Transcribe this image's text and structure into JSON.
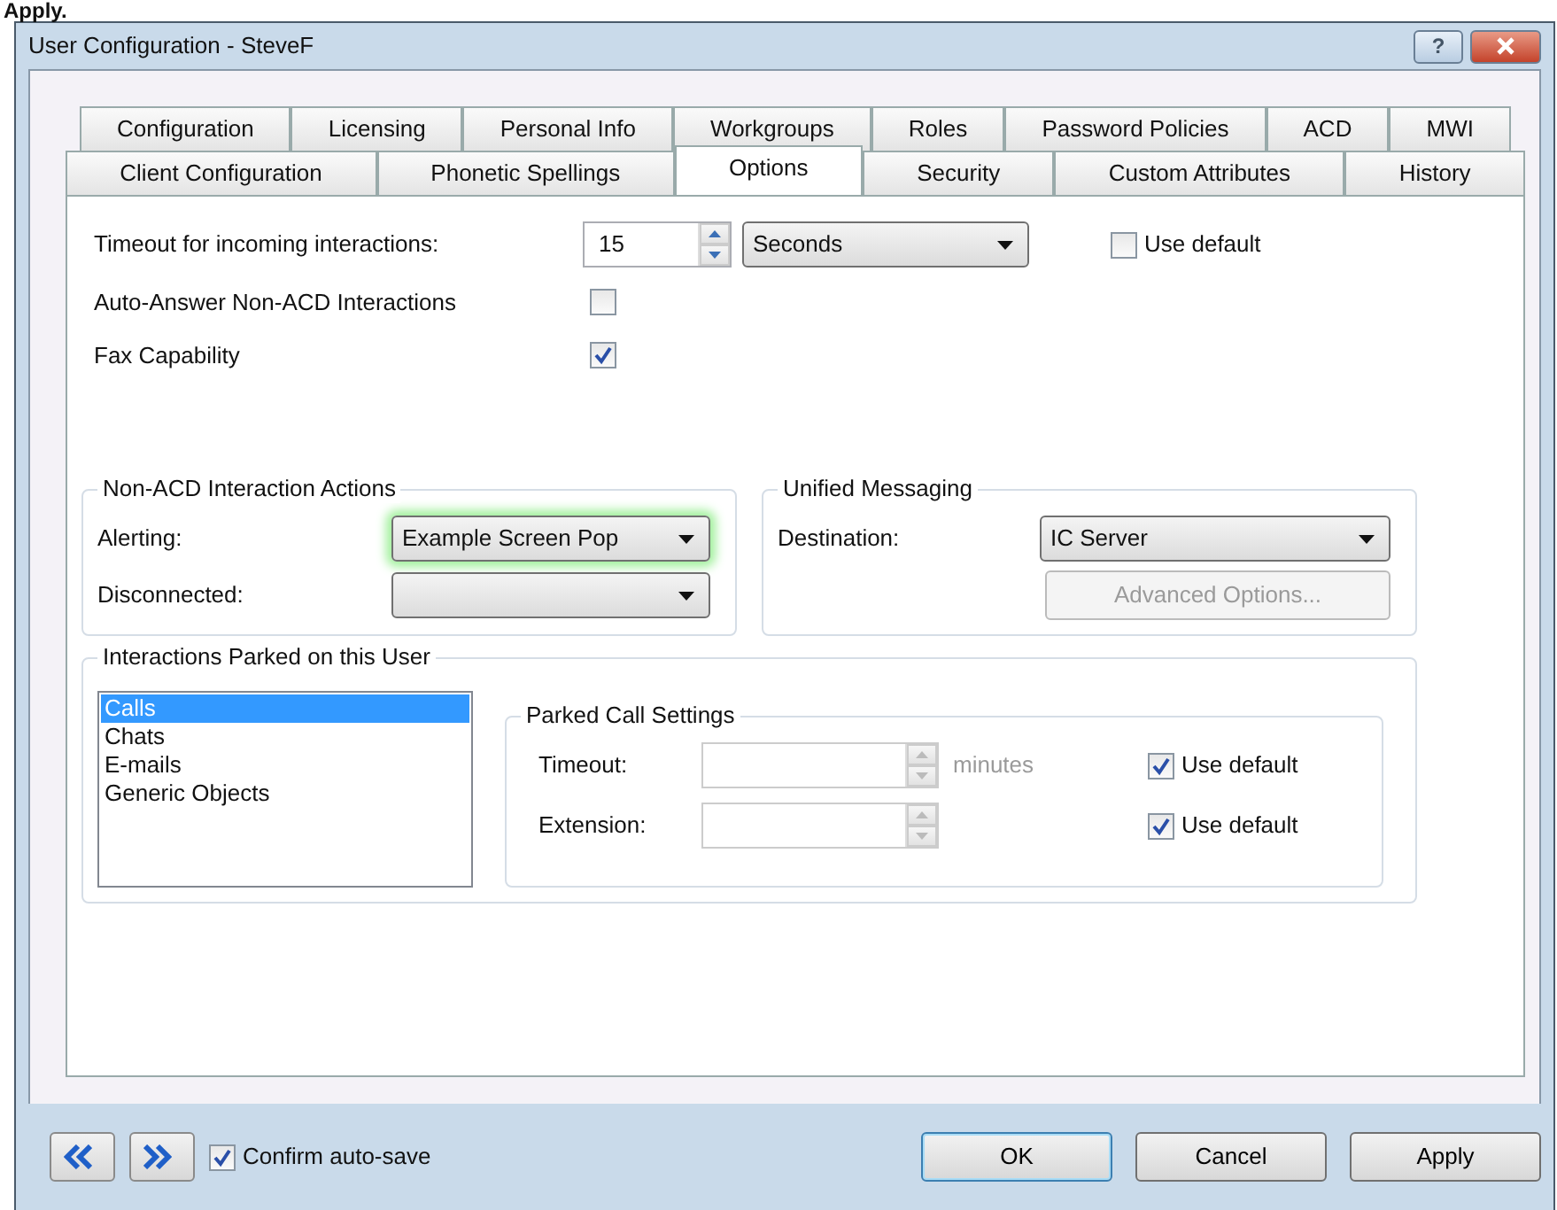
{
  "page_caption": "Apply.",
  "window": {
    "title": "User Configuration - SteveF",
    "help_button": "?"
  },
  "tab_rows": [
    [
      {
        "label": "Configuration",
        "selected": false
      },
      {
        "label": "Licensing",
        "selected": false
      },
      {
        "label": "Personal Info",
        "selected": false
      },
      {
        "label": "Workgroups",
        "selected": false
      },
      {
        "label": "Roles",
        "selected": false
      },
      {
        "label": "Password Policies",
        "selected": false
      },
      {
        "label": "ACD",
        "selected": false
      },
      {
        "label": "MWI",
        "selected": false
      }
    ],
    [
      {
        "label": "Client Configuration",
        "selected": false
      },
      {
        "label": "Phonetic Spellings",
        "selected": false
      },
      {
        "label": "Options",
        "selected": true
      },
      {
        "label": "Security",
        "selected": false
      },
      {
        "label": "Custom Attributes",
        "selected": false
      },
      {
        "label": "History",
        "selected": false
      }
    ]
  ],
  "timeout": {
    "label": "Timeout for incoming interactions:",
    "value": "15",
    "unit": "Seconds",
    "use_default": {
      "label": "Use default",
      "checked": false
    }
  },
  "toggles": [
    {
      "label": "Auto-Answer Non-ACD Interactions",
      "checked": false
    },
    {
      "label": "Fax Capability",
      "checked": true
    }
  ],
  "interaction_actions": {
    "title": "Non-ACD Interaction Actions",
    "rows": [
      {
        "label": "Alerting:",
        "value": "Example Screen Pop",
        "highlighted": true
      },
      {
        "label": "Disconnected:",
        "highlighted": false
      }
    ]
  },
  "unified_messaging": {
    "title": "Unified Messaging",
    "destination": {
      "label": "Destination:",
      "value": "IC Server"
    },
    "advanced_button": {
      "label": "Advanced Options...",
      "disabled": true
    }
  },
  "parked": {
    "title": "Interactions Parked on this User",
    "types": [
      {
        "label": "Calls",
        "selected": true
      },
      {
        "label": "Chats",
        "selected": false
      },
      {
        "label": "E-mails",
        "selected": false
      },
      {
        "label": "Generic Objects",
        "selected": false
      }
    ],
    "settings": {
      "title": "Parked Call Settings",
      "disabled": true,
      "rows": [
        {
          "label": "Timeout:",
          "unit": "minutes",
          "use_default": {
            "label": "Use default",
            "checked": true
          }
        },
        {
          "label": "Extension:",
          "use_default": {
            "label": "Use default",
            "checked": true
          }
        }
      ]
    }
  },
  "footer": {
    "confirm": {
      "label": "Confirm auto-save",
      "checked": true
    },
    "buttons": [
      {
        "label": "OK",
        "kind": "default"
      },
      {
        "label": "Cancel",
        "kind": "normal"
      },
      {
        "label": "Apply",
        "kind": "normal"
      }
    ]
  }
}
